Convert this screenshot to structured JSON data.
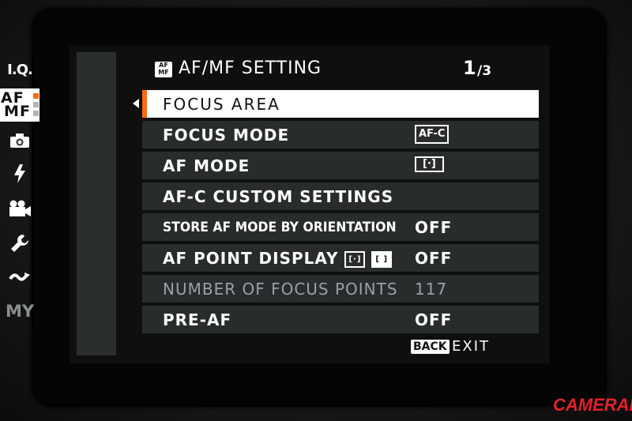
{
  "sidebar": {
    "items": [
      {
        "label": "I.Q.",
        "icon": "image-quality-icon"
      },
      {
        "label_top": "AF",
        "label_bottom": "MF",
        "icon": "af-mf-icon",
        "active": true
      },
      {
        "label": "",
        "icon": "camera-icon"
      },
      {
        "label": "",
        "icon": "flash-icon"
      },
      {
        "label": "",
        "icon": "movie-camera-icon"
      },
      {
        "label": "",
        "icon": "wrench-icon"
      },
      {
        "label": "",
        "icon": "wireless-icon"
      },
      {
        "label": "MY",
        "icon": "my-menu-icon"
      }
    ]
  },
  "header": {
    "icon_top": "AF",
    "icon_bottom": "MF",
    "title": "AF/MF SETTING",
    "page_current": "1",
    "page_total": "/3"
  },
  "menu": {
    "items": [
      {
        "label": "FOCUS AREA",
        "value": "",
        "selected": true
      },
      {
        "label": "FOCUS MODE",
        "badge": "AF-C"
      },
      {
        "label": "AF MODE",
        "badge": "[·]"
      },
      {
        "label": "AF-C CUSTOM SETTINGS",
        "value": ""
      },
      {
        "label": "STORE AF MODE BY ORIENTATION",
        "value": "OFF"
      },
      {
        "label": "AF POINT DISPLAY",
        "value": "OFF",
        "inline_icons": [
          "[·]",
          "[ ]"
        ]
      },
      {
        "label": "NUMBER OF FOCUS POINTS",
        "value": "117",
        "disabled": true
      },
      {
        "label": "PRE-AF",
        "value": "OFF"
      }
    ]
  },
  "footer": {
    "back_label": "BACK",
    "exit_label": "EXIT"
  },
  "watermark": {
    "text": "CAMERART"
  },
  "colors": {
    "accent": "#ff6a13",
    "row_bg": "#282c2d",
    "sidebar_bg": "#2a2e2f",
    "watermark": "#e5202a"
  }
}
